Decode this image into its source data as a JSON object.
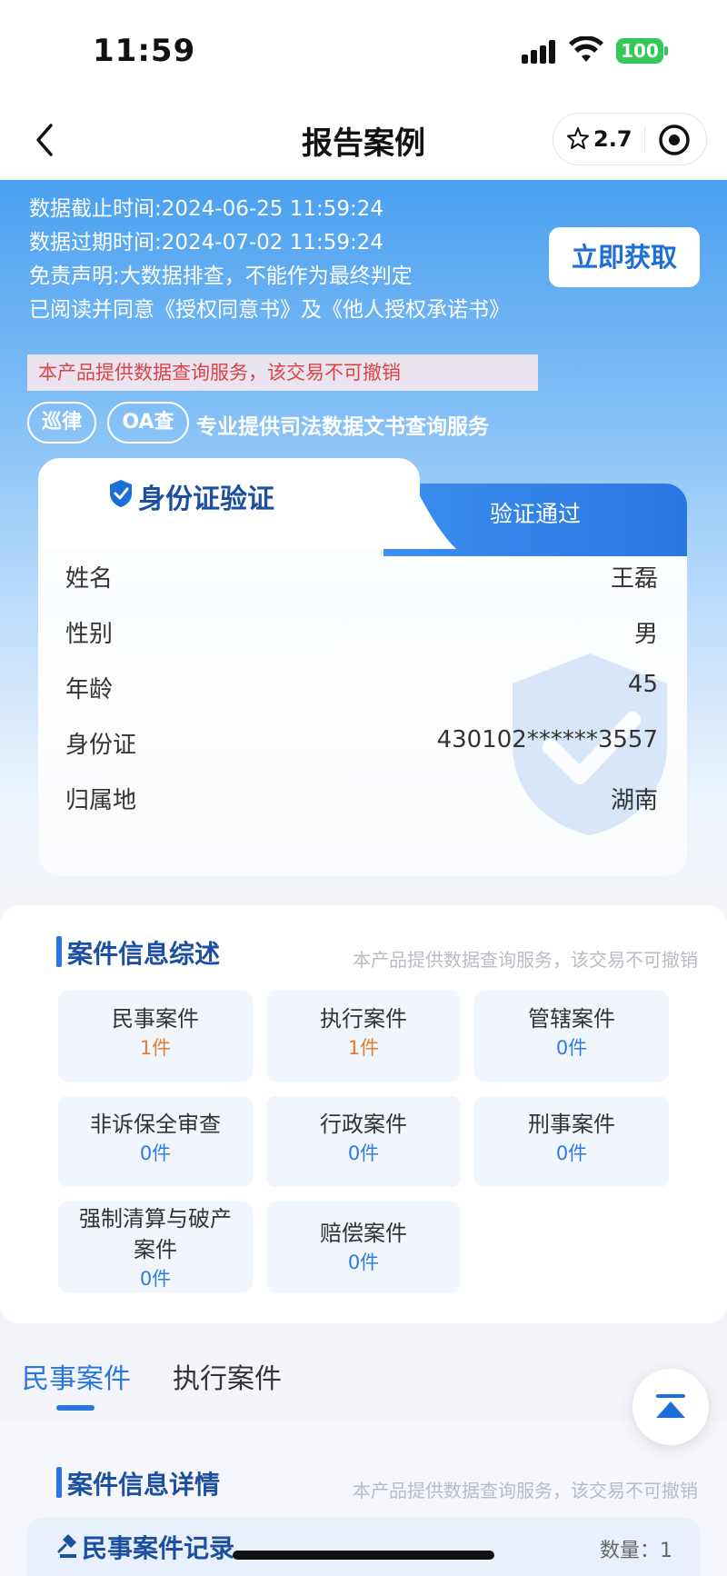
{
  "status": {
    "time": "11:59",
    "battery": "100"
  },
  "nav": {
    "title": "报告案例",
    "rating": "2.7"
  },
  "hero": {
    "lines": [
      "数据截止时间:2024-06-25 11:59:24",
      "数据过期时间:2024-07-02 11:59:24",
      "免责声明:大数据排查，不能作为最终判定",
      "已阅读并同意《授权同意书》及《他人授权承诺书》"
    ],
    "get_button": "立即获取",
    "warning": "本产品提供数据查询服务，该交易不可撤销",
    "brand_logo1": "巡律",
    "brand_logo2": "OA查",
    "brand_text": "专业提供司法数据文书查询服务"
  },
  "id_card": {
    "title": "身份证验证",
    "badge": "验证通过",
    "rows": [
      {
        "key": "姓名",
        "value": "王磊"
      },
      {
        "key": "性别",
        "value": "男"
      },
      {
        "key": "年龄",
        "value": "45"
      },
      {
        "key": "身份证",
        "value": "430102******3557"
      },
      {
        "key": "归属地",
        "value": "湖南"
      }
    ]
  },
  "summary": {
    "title": "案件信息综述",
    "note": "本产品提供数据查询服务，该交易不可撤销",
    "cells": [
      {
        "name": "民事案件",
        "count": "1件"
      },
      {
        "name": "执行案件",
        "count": "1件"
      },
      {
        "name": "管辖案件",
        "count": "0件"
      },
      {
        "name": "非诉保全审查",
        "count": "0件"
      },
      {
        "name": "行政案件",
        "count": "0件"
      },
      {
        "name": "刑事案件",
        "count": "0件"
      },
      {
        "name_line1": "强制清算与破产",
        "name_line2": "案件",
        "count": "0件"
      },
      {
        "name": "赔偿案件",
        "count": "0件"
      }
    ]
  },
  "tabs": [
    {
      "label": "民事案件"
    },
    {
      "label": "执行案件"
    }
  ],
  "detail": {
    "title": "案件信息详情",
    "note": "本产品提供数据查询服务，该交易不可撤销",
    "record_title": "民事案件记录",
    "record_count": "数量：1"
  },
  "colors": {
    "primary": "#2a76e0",
    "warning": "#d94646",
    "highlight": "#e37c2c"
  }
}
